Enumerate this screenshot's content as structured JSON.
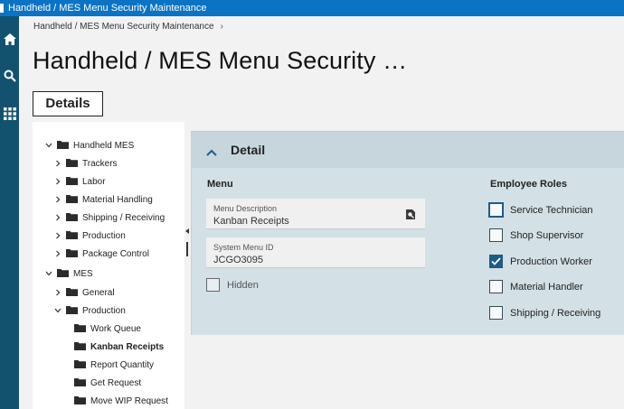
{
  "window": {
    "title": "Handheld / MES Menu Security Maintenance"
  },
  "sidebar": {
    "items": [
      {
        "icon": "home-icon"
      },
      {
        "icon": "search-icon"
      },
      {
        "icon": "apps-grid-icon"
      }
    ]
  },
  "breadcrumb": {
    "item": "Handheld / MES Menu Security Maintenance",
    "separator": "›"
  },
  "page": {
    "title": "Handheld / MES Menu Security …"
  },
  "tabs": {
    "details": "Details"
  },
  "tree": {
    "nodes": [
      {
        "label": "Handheld MES",
        "state": "expanded"
      },
      {
        "label": "Trackers",
        "state": "collapsed"
      },
      {
        "label": "Labor",
        "state": "collapsed"
      },
      {
        "label": "Material Handling",
        "state": "collapsed"
      },
      {
        "label": "Shipping / Receiving",
        "state": "collapsed"
      },
      {
        "label": "Production",
        "state": "collapsed"
      },
      {
        "label": "Package Control",
        "state": "collapsed"
      },
      {
        "label": "MES",
        "state": "expanded"
      },
      {
        "label": "General",
        "state": "collapsed"
      },
      {
        "label": "Production",
        "state": "expanded"
      },
      {
        "label": "Work Queue",
        "state": "leaf"
      },
      {
        "label": "Kanban Receipts",
        "state": "leaf",
        "selected": true
      },
      {
        "label": "Report Quantity",
        "state": "leaf"
      },
      {
        "label": "Get Request",
        "state": "leaf"
      },
      {
        "label": "Move WIP Request",
        "state": "leaf"
      }
    ]
  },
  "detail": {
    "title": "Detail",
    "menu_section": "Menu",
    "roles_section": "Employee Roles",
    "menu_description": {
      "label": "Menu Description",
      "value": "Kanban Receipts"
    },
    "system_menu_id": {
      "label": "System Menu ID",
      "value": "JCGO3095"
    },
    "hidden": {
      "label": "Hidden",
      "checked": false
    },
    "roles": [
      {
        "label": "Service Technician",
        "checked": false
      },
      {
        "label": "Shop Supervisor",
        "checked": false
      },
      {
        "label": "Production Worker",
        "checked": true
      },
      {
        "label": "Material Handler",
        "checked": false
      },
      {
        "label": "Shipping / Receiving",
        "checked": false
      }
    ]
  },
  "colors": {
    "titlebar": "#0b73c4",
    "sidebar": "#13526f",
    "panel": "#d3e0e5",
    "accent": "#1d5c86"
  }
}
